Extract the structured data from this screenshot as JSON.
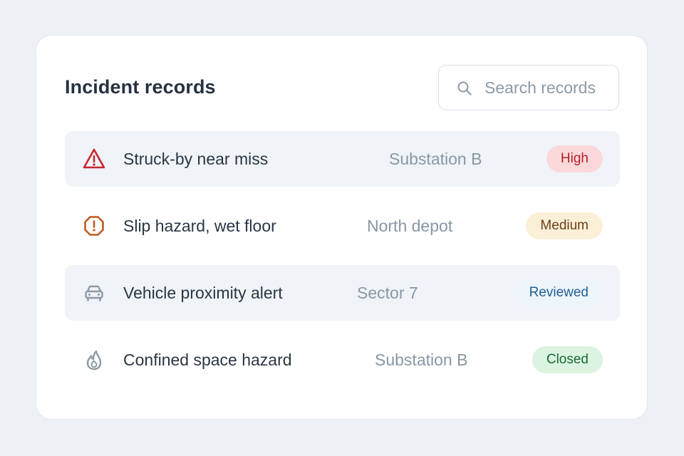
{
  "panel": {
    "title": "Incident records",
    "search": {
      "placeholder": "Search records",
      "value": "",
      "icon": "search-icon"
    }
  },
  "incidents": [
    {
      "name": "Struck-by near miss",
      "location": "Substation B",
      "severity": "High",
      "icon": "warning-triangle-icon",
      "icon_color": "#c8262e",
      "badge_bg": "#fbd9db",
      "badge_fg": "#b3202a",
      "highlighted": true
    },
    {
      "name": "Slip hazard, wet floor",
      "location": "North depot",
      "severity": "Medium",
      "icon": "alert-octagon-icon",
      "icon_color": "#c25a1c",
      "badge_bg": "#fcefd8",
      "badge_fg": "#6b3f12",
      "highlighted": false
    },
    {
      "name": "Vehicle proximity alert",
      "location": "Sector 7",
      "severity": "Reviewed",
      "icon": "car-icon",
      "icon_color": "#8d9aa6",
      "badge_bg": "#edf5fb",
      "badge_fg": "#1f5f94",
      "highlighted": true
    },
    {
      "name": "Confined space hazard",
      "location": "Substation B",
      "severity": "Closed",
      "icon": "flame-icon",
      "icon_color": "#8d9aa6",
      "badge_bg": "#dbf3e1",
      "badge_fg": "#1d6a36",
      "highlighted": false
    }
  ]
}
